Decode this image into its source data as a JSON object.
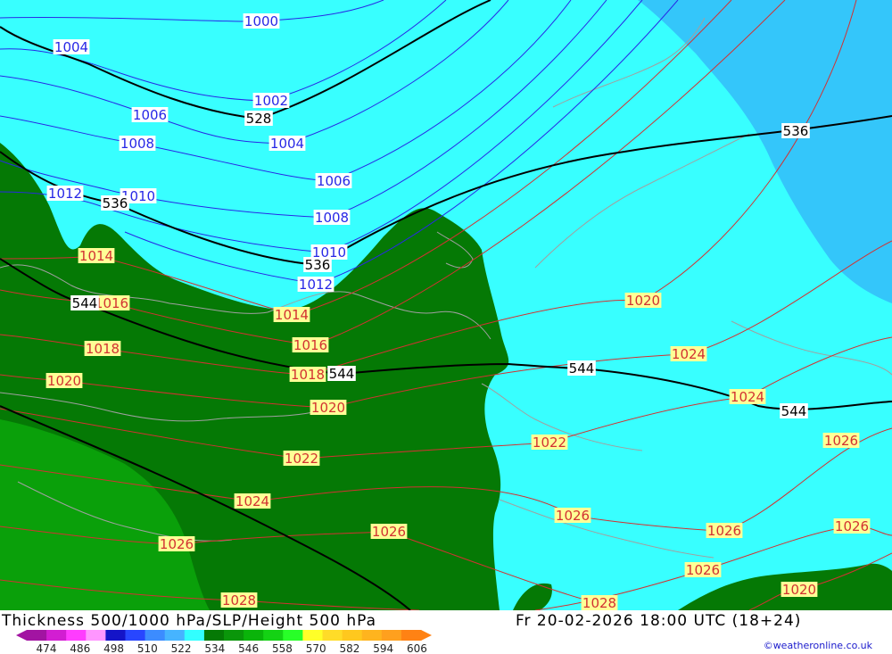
{
  "map": {
    "title": "Thickness 500/1000 hPa/SLP/Height 500 hPa",
    "datetime": "Fr 20-02-2026 18:00 UTC (18+24)",
    "credit": "©weatheronline.co.uk",
    "colors": {
      "cyan_band": "#38ffff",
      "blue_band": "#34c6fa",
      "dark_green_band": "#057905",
      "mid_green_band": "#0aa00a",
      "isobar_low": "#2828e6",
      "isobar_high": "#d23232",
      "height_contour": "#000000",
      "coastline": "#a0a0a0"
    },
    "pressure_labels": [
      {
        "text": "1000",
        "kind": "low"
      },
      {
        "text": "1004",
        "kind": "low"
      },
      {
        "text": "1002",
        "kind": "low"
      },
      {
        "text": "1006",
        "kind": "low"
      },
      {
        "text": "1008",
        "kind": "low"
      },
      {
        "text": "1004",
        "kind": "low"
      },
      {
        "text": "1006",
        "kind": "low"
      },
      {
        "text": "1012",
        "kind": "low"
      },
      {
        "text": "1010",
        "kind": "low"
      },
      {
        "text": "1008",
        "kind": "low"
      },
      {
        "text": "1010",
        "kind": "low"
      },
      {
        "text": "1012",
        "kind": "low"
      },
      {
        "text": "1014",
        "kind": "high"
      },
      {
        "text": "1016",
        "kind": "high"
      },
      {
        "text": "1014",
        "kind": "high"
      },
      {
        "text": "1018",
        "kind": "high"
      },
      {
        "text": "1016",
        "kind": "high"
      },
      {
        "text": "1020",
        "kind": "high"
      },
      {
        "text": "1018",
        "kind": "high"
      },
      {
        "text": "1020",
        "kind": "high"
      },
      {
        "text": "1020",
        "kind": "high"
      },
      {
        "text": "1022",
        "kind": "high"
      },
      {
        "text": "1024",
        "kind": "high"
      },
      {
        "text": "1022",
        "kind": "high"
      },
      {
        "text": "1024",
        "kind": "high"
      },
      {
        "text": "1024",
        "kind": "high"
      },
      {
        "text": "1026",
        "kind": "high"
      },
      {
        "text": "1026",
        "kind": "high"
      },
      {
        "text": "1026",
        "kind": "high"
      },
      {
        "text": "1026",
        "kind": "high"
      },
      {
        "text": "1026",
        "kind": "high"
      },
      {
        "text": "1026",
        "kind": "high"
      },
      {
        "text": "1026",
        "kind": "high"
      },
      {
        "text": "1028",
        "kind": "high"
      },
      {
        "text": "1028",
        "kind": "high"
      },
      {
        "text": "1020",
        "kind": "high"
      }
    ],
    "height_labels": [
      {
        "text": "528"
      },
      {
        "text": "536"
      },
      {
        "text": "536"
      },
      {
        "text": "536"
      },
      {
        "text": "544"
      },
      {
        "text": "544"
      },
      {
        "text": "544"
      },
      {
        "text": "544"
      }
    ],
    "legend": {
      "ticks": [
        "474",
        "486",
        "498",
        "510",
        "522",
        "534",
        "546",
        "558",
        "570",
        "582",
        "594",
        "606"
      ],
      "colors": [
        "#a214a2",
        "#d21ed2",
        "#ff3cff",
        "#ff96ff",
        "#1414c8",
        "#2846ff",
        "#3c8cff",
        "#46b4ff",
        "#32ffff",
        "#057905",
        "#0a960a",
        "#0ab40a",
        "#14d214",
        "#28ff28",
        "#ffff28",
        "#ffdc28",
        "#ffc81e",
        "#ffb41e",
        "#ffa01e",
        "#ff8214"
      ]
    }
  }
}
